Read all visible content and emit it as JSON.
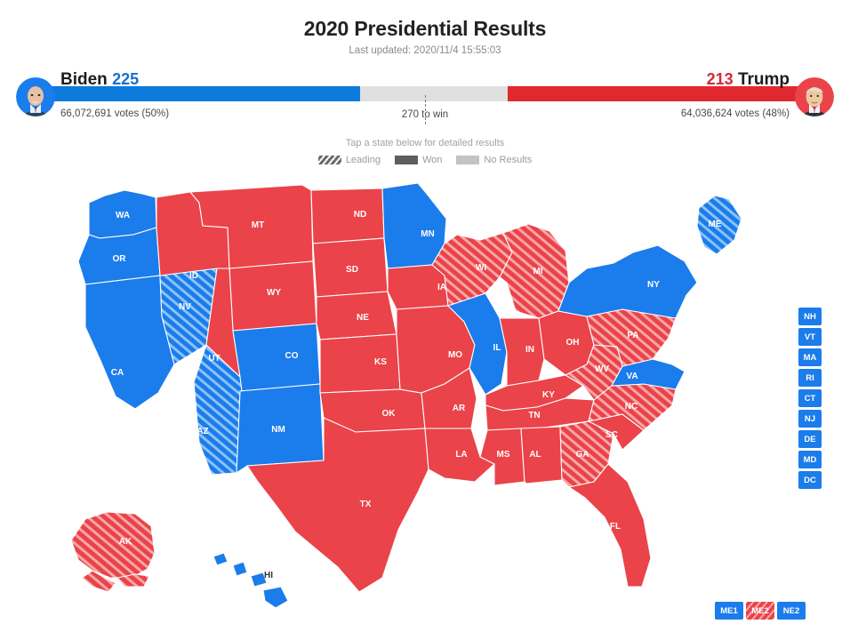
{
  "header": {
    "title": "2020 Presidential Results",
    "last_updated": "Last updated: 2020/11/4 15:55:03"
  },
  "race": {
    "win_threshold_label": "270 to win",
    "colors": {
      "blue": "#1b7ceb",
      "red": "#ea4349",
      "bar_blue": "#0d7bdc",
      "bar_red": "#e2282f",
      "no_results": "#e0e0e0"
    },
    "biden": {
      "name": "Biden",
      "electoral_votes": "225",
      "votes_line": "66,072,691 votes (50%)",
      "bar_percent": 42.0,
      "avatar": "biden-portrait"
    },
    "trump": {
      "name": "Trump",
      "electoral_votes": "213",
      "votes_line": "64,036,624 votes (48%)",
      "bar_percent": 39.8,
      "avatar": "trump-portrait"
    }
  },
  "map_hint": "Tap a state below for detailed results",
  "legend": [
    {
      "key": "leading",
      "label": "Leading"
    },
    {
      "key": "won",
      "label": "Won"
    },
    {
      "key": "none",
      "label": "No Results"
    }
  ],
  "chips_column": [
    {
      "code": "NH",
      "party": "blue",
      "status": "won"
    },
    {
      "code": "VT",
      "party": "blue",
      "status": "won"
    },
    {
      "code": "MA",
      "party": "blue",
      "status": "won"
    },
    {
      "code": "RI",
      "party": "blue",
      "status": "won"
    },
    {
      "code": "CT",
      "party": "blue",
      "status": "won"
    },
    {
      "code": "NJ",
      "party": "blue",
      "status": "won"
    },
    {
      "code": "DE",
      "party": "blue",
      "status": "won"
    },
    {
      "code": "MD",
      "party": "blue",
      "status": "won"
    },
    {
      "code": "DC",
      "party": "blue",
      "status": "won"
    }
  ],
  "chips_row": [
    {
      "code": "ME1",
      "party": "blue",
      "status": "won"
    },
    {
      "code": "ME2",
      "party": "red",
      "status": "leading"
    },
    {
      "code": "NE2",
      "party": "blue",
      "status": "won"
    }
  ],
  "states": [
    {
      "code": "WA",
      "party": "blue",
      "status": "won"
    },
    {
      "code": "OR",
      "party": "blue",
      "status": "won"
    },
    {
      "code": "CA",
      "party": "blue",
      "status": "won"
    },
    {
      "code": "NV",
      "party": "blue",
      "status": "leading"
    },
    {
      "code": "ID",
      "party": "red",
      "status": "won"
    },
    {
      "code": "MT",
      "party": "red",
      "status": "won"
    },
    {
      "code": "WY",
      "party": "red",
      "status": "won"
    },
    {
      "code": "UT",
      "party": "red",
      "status": "won"
    },
    {
      "code": "AZ",
      "party": "blue",
      "status": "leading"
    },
    {
      "code": "CO",
      "party": "blue",
      "status": "won"
    },
    {
      "code": "NM",
      "party": "blue",
      "status": "won"
    },
    {
      "code": "ND",
      "party": "red",
      "status": "won"
    },
    {
      "code": "SD",
      "party": "red",
      "status": "won"
    },
    {
      "code": "NE",
      "party": "red",
      "status": "won"
    },
    {
      "code": "KS",
      "party": "red",
      "status": "won"
    },
    {
      "code": "OK",
      "party": "red",
      "status": "won"
    },
    {
      "code": "TX",
      "party": "red",
      "status": "won"
    },
    {
      "code": "MN",
      "party": "blue",
      "status": "won"
    },
    {
      "code": "IA",
      "party": "red",
      "status": "won"
    },
    {
      "code": "MO",
      "party": "red",
      "status": "won"
    },
    {
      "code": "AR",
      "party": "red",
      "status": "won"
    },
    {
      "code": "LA",
      "party": "red",
      "status": "won"
    },
    {
      "code": "WI",
      "party": "red",
      "status": "leading"
    },
    {
      "code": "IL",
      "party": "blue",
      "status": "won"
    },
    {
      "code": "MI",
      "party": "red",
      "status": "leading"
    },
    {
      "code": "IN",
      "party": "red",
      "status": "won"
    },
    {
      "code": "OH",
      "party": "red",
      "status": "won"
    },
    {
      "code": "KY",
      "party": "red",
      "status": "won"
    },
    {
      "code": "TN",
      "party": "red",
      "status": "won"
    },
    {
      "code": "MS",
      "party": "red",
      "status": "won"
    },
    {
      "code": "AL",
      "party": "red",
      "status": "won"
    },
    {
      "code": "GA",
      "party": "red",
      "status": "leading"
    },
    {
      "code": "FL",
      "party": "red",
      "status": "won"
    },
    {
      "code": "SC",
      "party": "red",
      "status": "won"
    },
    {
      "code": "NC",
      "party": "red",
      "status": "leading"
    },
    {
      "code": "WV",
      "party": "red",
      "status": "leading"
    },
    {
      "code": "VA",
      "party": "blue",
      "status": "won"
    },
    {
      "code": "PA",
      "party": "red",
      "status": "leading"
    },
    {
      "code": "NY",
      "party": "blue",
      "status": "won"
    },
    {
      "code": "ME",
      "party": "blue",
      "status": "leading"
    },
    {
      "code": "AK",
      "party": "red",
      "status": "leading"
    },
    {
      "code": "HI",
      "party": "blue",
      "status": "won"
    }
  ]
}
